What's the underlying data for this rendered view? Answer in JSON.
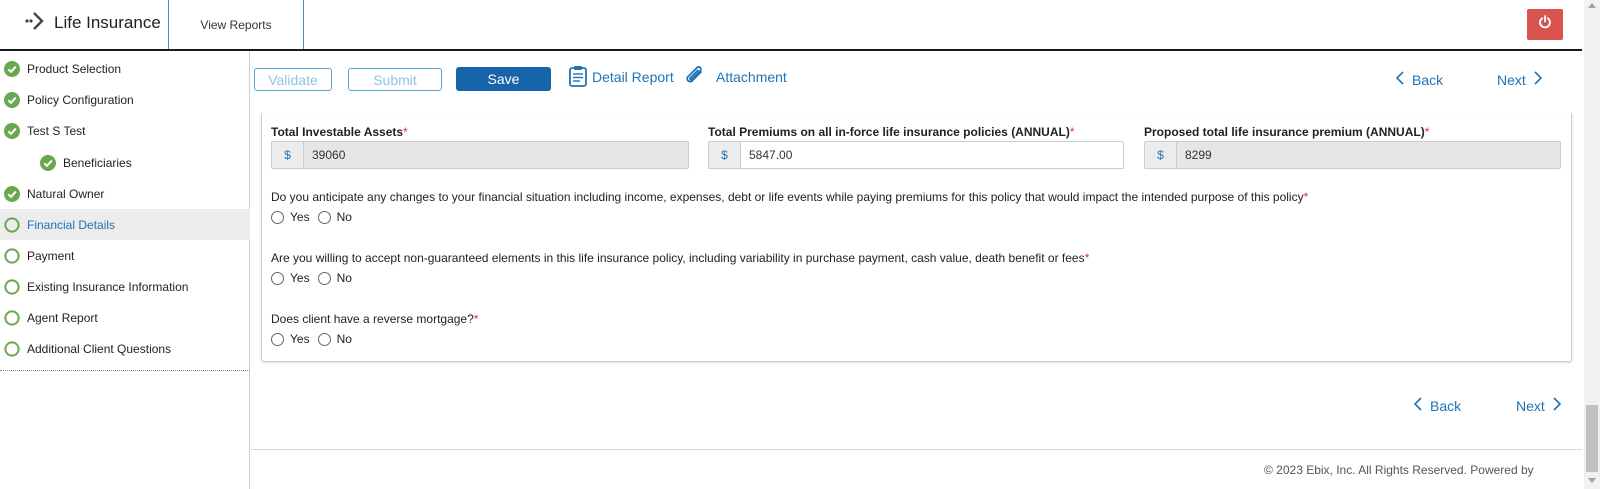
{
  "header": {
    "app_title": "Life Insurance",
    "view_reports": "View Reports",
    "logo_icon": "chevron-dots-logo-icon",
    "power_icon": "power-icon",
    "power_color": "#d9534f"
  },
  "sidebar": {
    "items": [
      {
        "label": "Product Selection",
        "status": "complete"
      },
      {
        "label": "Policy Configuration",
        "status": "complete"
      },
      {
        "label": "Test S Test",
        "status": "complete"
      },
      {
        "label": "Beneficiaries",
        "status": "complete"
      },
      {
        "label": "Natural Owner",
        "status": "complete"
      },
      {
        "label": "Financial Details",
        "status": "active"
      },
      {
        "label": "Payment",
        "status": "incomplete"
      },
      {
        "label": "Existing Insurance Information",
        "status": "incomplete"
      },
      {
        "label": "Agent Report",
        "status": "incomplete"
      },
      {
        "label": "Additional Client Questions",
        "status": "incomplete"
      }
    ],
    "complete_color": "#6aa84f"
  },
  "toolbar": {
    "validate": "Validate",
    "submit": "Submit",
    "save": "Save",
    "detail_report": "Detail Report",
    "attachment": "Attachment",
    "back": "Back",
    "next": "Next"
  },
  "form": {
    "fields": [
      {
        "label": "Total Investable Assets",
        "currency": "$",
        "value": "39060"
      },
      {
        "label": "Total Premiums on all in-force life insurance policies (ANNUAL)",
        "currency": "$",
        "value": "5847.00"
      },
      {
        "label": "Proposed total life insurance premium (ANNUAL)",
        "currency": "$",
        "value": "8299"
      }
    ],
    "required_mark": "*",
    "questions": [
      {
        "text": "Do you anticipate any changes to your financial situation including income, expenses, debt or life events while paying premiums for this policy that would impact the intended purpose of this policy"
      },
      {
        "text": "Are you willing to accept non-guaranteed elements in this life insurance policy, including variability in purchase payment, cash value, death benefit or fees"
      },
      {
        "text": "Does client have a reverse mortgage?"
      }
    ],
    "yes": "Yes",
    "no": "No"
  },
  "bottom_nav": {
    "back": "Back",
    "next": "Next"
  },
  "footer": {
    "copyright": "© 2023 Ebix, Inc. All Rights Reserved. Powered by"
  },
  "colors": {
    "accent": "#1f73b7",
    "save_bg": "#1864ab",
    "required": "#d9322e"
  }
}
